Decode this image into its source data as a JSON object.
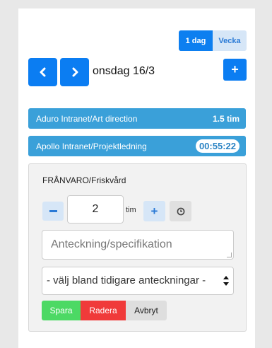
{
  "view_toggle": {
    "day": "1 dag",
    "week": "Vecka",
    "selected": "day"
  },
  "nav": {
    "current_date": "onsdag 16/3"
  },
  "entries": [
    {
      "project": "Aduro Intranet/Art direction",
      "value": "1.5 tim"
    },
    {
      "project": "Apollo Intranet/Projektledning",
      "value": "00:55:22"
    }
  ],
  "absence": {
    "title": "FRÅNVARO/Friskvård",
    "hours": "2",
    "unit": "tim",
    "note_placeholder": "Anteckning/specifikation",
    "select_value": "- välj bland tidigare anteckningar -",
    "save_label": "Spara",
    "delete_label": "Radera",
    "cancel_label": "Avbryt"
  },
  "colors": {
    "primary": "#0b7df2",
    "entry": "#3aa0d9",
    "save": "#4cd964",
    "delete": "#f03a3a"
  },
  "icons": [
    "chevron-left-icon",
    "chevron-right-icon",
    "plus-icon",
    "minus-icon",
    "clock-icon",
    "select-arrows-icon"
  ]
}
